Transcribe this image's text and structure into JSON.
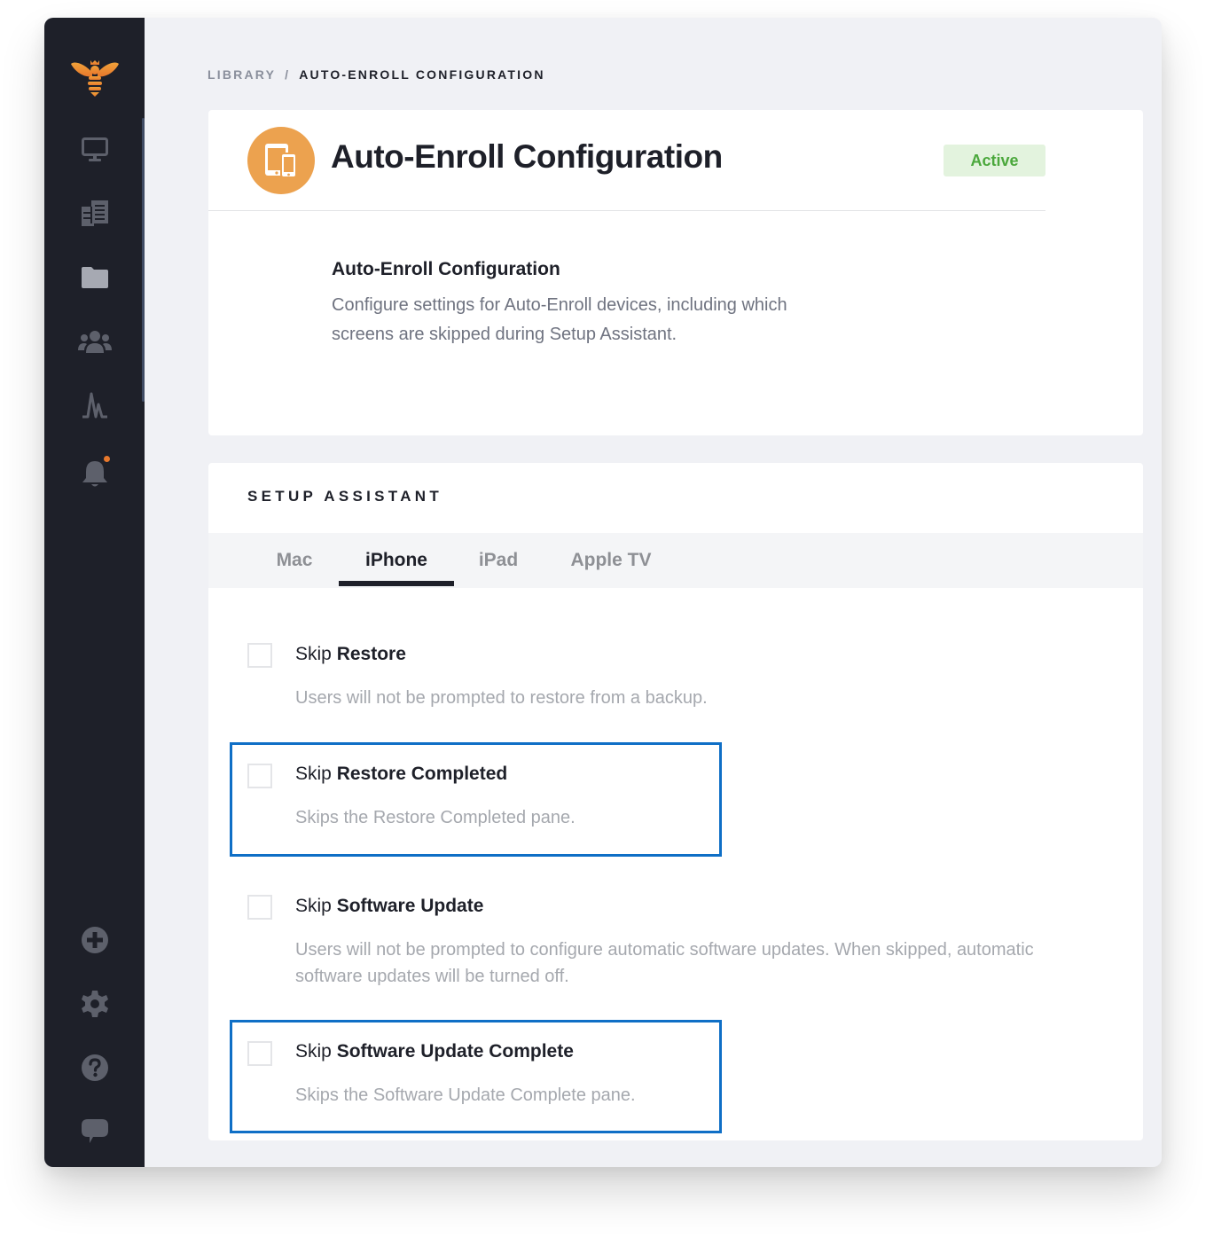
{
  "breadcrumb": {
    "root": "LIBRARY",
    "separator": "/",
    "current": "AUTO-ENROLL CONFIGURATION"
  },
  "sidebar": {
    "logo": "bee-logo",
    "items": [
      {
        "icon": "monitor-icon",
        "label": "Devices"
      },
      {
        "icon": "documents-icon",
        "label": "Blueprints"
      },
      {
        "icon": "folder-icon",
        "label": "Library"
      },
      {
        "icon": "users-icon",
        "label": "Users"
      },
      {
        "icon": "activity-icon",
        "label": "Activity"
      },
      {
        "icon": "bell-icon",
        "label": "Alerts",
        "has_notification": true
      }
    ],
    "bottom_items": [
      {
        "icon": "plus-circle-icon",
        "label": "Add"
      },
      {
        "icon": "gear-icon",
        "label": "Settings"
      },
      {
        "icon": "help-icon",
        "label": "Help"
      },
      {
        "icon": "chat-icon",
        "label": "Chat"
      }
    ]
  },
  "header": {
    "icon": "devices-icon",
    "title": "Auto-Enroll Configuration",
    "status": "Active",
    "description_title": "Auto-Enroll Configuration",
    "description": "Configure settings for Auto-Enroll devices, including which screens are skipped during Setup Assistant."
  },
  "setup_assistant": {
    "title": "SETUP ASSISTANT",
    "tabs": [
      {
        "label": "Mac",
        "active": false
      },
      {
        "label": "iPhone",
        "active": true
      },
      {
        "label": "iPad",
        "active": false
      },
      {
        "label": "Apple TV",
        "active": false
      }
    ],
    "options": [
      {
        "prefix": "Skip",
        "name": "Restore",
        "description": "Users will not be prompted to restore from a backup.",
        "checked": false,
        "highlighted": false
      },
      {
        "prefix": "Skip",
        "name": "Restore Completed",
        "description": "Skips the Restore Completed pane.",
        "checked": false,
        "highlighted": true
      },
      {
        "prefix": "Skip",
        "name": "Software Update",
        "description": "Users will not be prompted to configure automatic software updates. When skipped, automatic software updates will be turned off.",
        "checked": false,
        "highlighted": false
      },
      {
        "prefix": "Skip",
        "name": "Software Update Complete",
        "description": "Skips the Software Update Complete pane.",
        "checked": false,
        "highlighted": true
      }
    ]
  },
  "colors": {
    "accent_orange": "#eca24f",
    "status_green": "#4ba83c",
    "highlight_blue": "#0f6fc6",
    "sidebar_bg": "#1e2029"
  }
}
